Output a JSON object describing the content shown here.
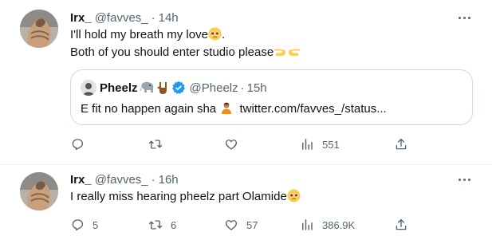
{
  "tweets": [
    {
      "name": "Irx_",
      "handle": "@favves_",
      "sep": "·",
      "time": "14h",
      "line1": "I'll hold my breath my love",
      "line1_end": ".",
      "line2": "Both of you should enter studio please",
      "quote": {
        "name": "Pheelz",
        "handle": "@Pheelz",
        "sep": "·",
        "time": "15h",
        "text": "E fit no happen again sha",
        "link": "twitter.com/favves_/status..."
      },
      "actions": {
        "reply": "",
        "retweet": "",
        "like": "",
        "views": "551"
      },
      "colors": {
        "verified": "#1d9bf0",
        "emoji": "#ffcc4d"
      }
    },
    {
      "name": "Irx_",
      "handle": "@favves_",
      "sep": "·",
      "time": "16h",
      "line1": "I really miss hearing pheelz part Olamide",
      "actions": {
        "reply": "5",
        "retweet": "6",
        "like": "57",
        "views": "386.9K"
      }
    }
  ],
  "icons": [
    "more-icon",
    "reply-icon",
    "retweet-icon",
    "like-icon",
    "views-icon",
    "share-icon",
    "verified-icon",
    "elephant-icon",
    "horns-icon",
    "pleading-face-emoji",
    "pointing-hand-emoji",
    "person-emoji"
  ]
}
